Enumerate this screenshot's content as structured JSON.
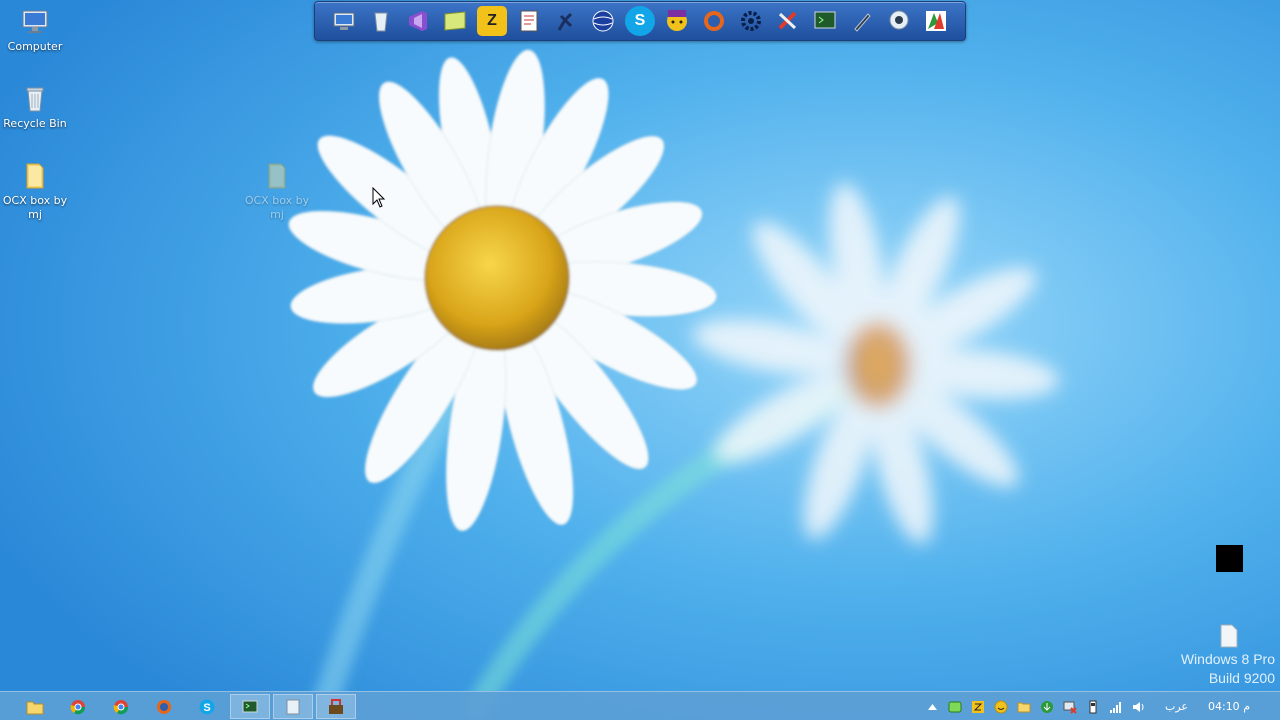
{
  "desktop_icons": [
    {
      "name": "computer",
      "label": "Computer",
      "icon": "computer-icon"
    },
    {
      "name": "recycle-bin",
      "label": "Recycle Bin",
      "icon": "recycle-bin-icon"
    },
    {
      "name": "ocx-folder",
      "label": "OCX box by mj",
      "icon": "folder-icon"
    },
    {
      "name": "ocx-folder-ghost",
      "label": "OCX box by mj",
      "icon": "folder-icon"
    }
  ],
  "dock_icons": [
    "control-panel-icon",
    "recycle-bin-icon",
    "visual-studio-icon",
    "notes-icon",
    "zip-archive-icon",
    "document-editor-icon",
    "runner-icon",
    "globe-icon",
    "skype-icon",
    "yahoo-messenger-icon",
    "firefox-icon",
    "settings-gear-icon",
    "tools-icon",
    "terminal-icon",
    "pen-icon",
    "webcam-icon",
    "media-app-icon"
  ],
  "taskbar": {
    "apps": [
      "file-explorer-icon",
      "chrome-icon",
      "chrome-icon",
      "firefox-icon",
      "skype-icon",
      "terminal-icon",
      "notepad-icon",
      "toolbox-icon"
    ],
    "active_index": 5
  },
  "tray": {
    "icons": [
      "chevron-up-icon",
      "sync-icon",
      "zip-icon",
      "emoticon-icon",
      "folder-icon",
      "download-icon",
      "network-error-icon",
      "usb-device-icon",
      "signal-icon",
      "volume-icon"
    ],
    "language": "عرب",
    "clock": "04:10 م"
  },
  "watermark": {
    "line1": "Windows 8 Pro",
    "line2": "Build 9200"
  },
  "colors": {
    "sky": "#2f93df",
    "taskbar": "#5ca0d6",
    "dock": "#2a5fb0"
  }
}
